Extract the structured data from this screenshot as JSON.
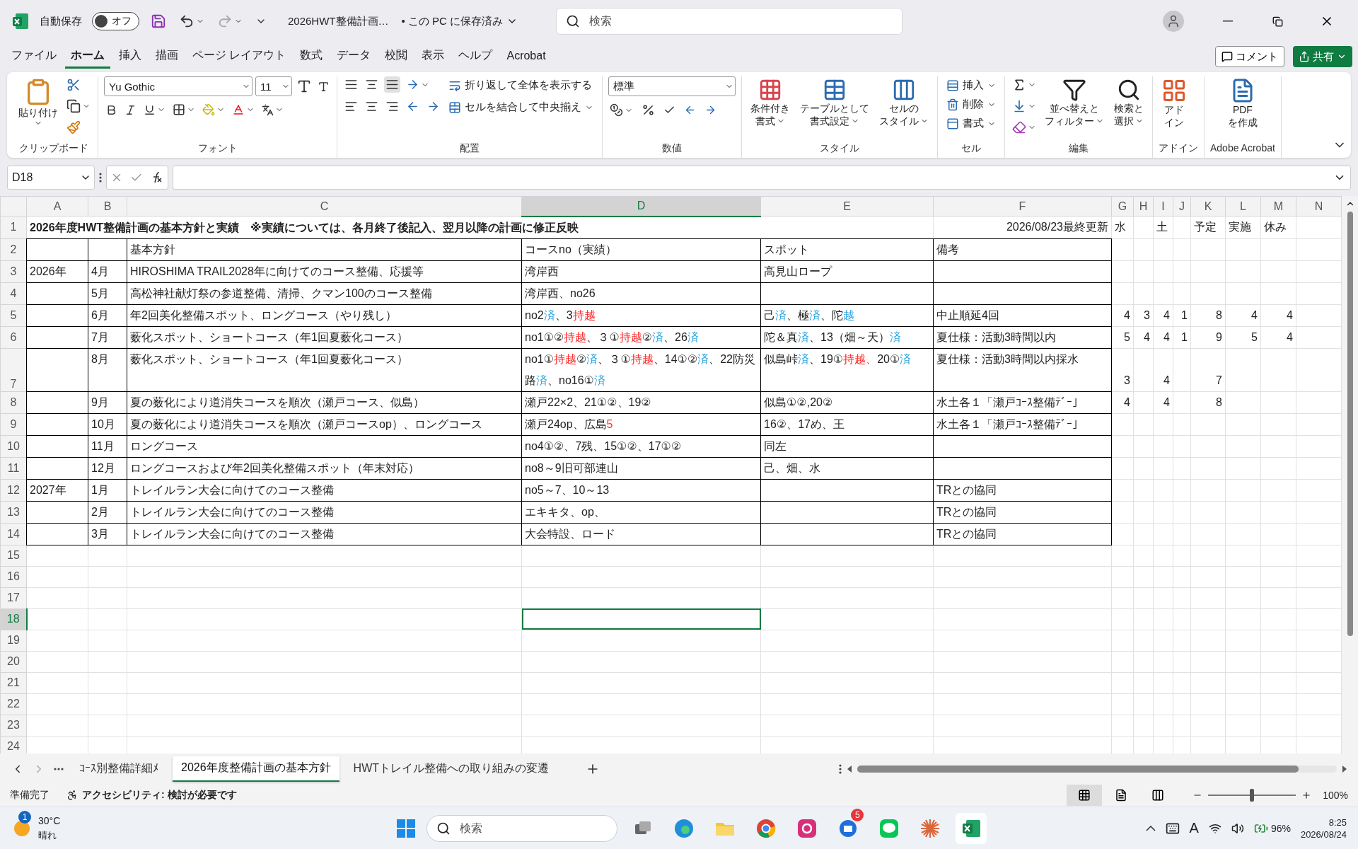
{
  "title_bar": {
    "autosave_label": "自動保存",
    "autosave": {
      "on": false,
      "label": "オフ"
    },
    "file_name": "2026HWT整備計画…",
    "save_status": "• この PC に保存済み",
    "search_placeholder": "検索"
  },
  "menu_tabs": [
    {
      "label": "ファイル",
      "selected": false
    },
    {
      "label": "ホーム",
      "selected": true
    },
    {
      "label": "挿入",
      "selected": false
    },
    {
      "label": "描画",
      "selected": false
    },
    {
      "label": "ページ レイアウト",
      "selected": false
    },
    {
      "label": "数式",
      "selected": false
    },
    {
      "label": "データ",
      "selected": false
    },
    {
      "label": "校閲",
      "selected": false
    },
    {
      "label": "表示",
      "selected": false
    },
    {
      "label": "ヘルプ",
      "selected": false
    },
    {
      "label": "Acrobat",
      "selected": false
    }
  ],
  "comment_button": "コメント",
  "share_button": "共有",
  "ribbon": {
    "clipboard": {
      "label": "クリップボード",
      "paste": "貼り付け"
    },
    "font": {
      "label": "フォント",
      "font_name": "Yu Gothic",
      "font_size": "11"
    },
    "alignment": {
      "label": "配置",
      "wrap": "折り返して全体を表示する",
      "merge": "セルを結合して中央揃え"
    },
    "number": {
      "label": "数値",
      "format": "標準"
    },
    "styles": {
      "label": "スタイル",
      "buttons": [
        [
          "条件付き",
          "書式"
        ],
        [
          "テーブルとして",
          "書式設定"
        ],
        [
          "セルの",
          "スタイル"
        ]
      ]
    },
    "cells": {
      "label": "セル",
      "buttons": [
        "挿入",
        "削除",
        "書式"
      ]
    },
    "editing": {
      "label": "編集",
      "buttons": [
        [
          "並べ替えと",
          "フィルター"
        ],
        [
          "検索と",
          "選択"
        ]
      ]
    },
    "addins": {
      "label": "アドイン",
      "button": [
        "アド",
        "イン"
      ]
    },
    "acrobat": {
      "label": "Adobe Acrobat",
      "button": [
        "PDF",
        "を作成"
      ]
    }
  },
  "formula_bar": {
    "name_box": "D18"
  },
  "sheet": {
    "column_headers": [
      {
        "label": "A",
        "selected": false
      },
      {
        "label": "B",
        "selected": false
      },
      {
        "label": "C",
        "selected": false
      },
      {
        "label": "D",
        "selected": true
      },
      {
        "label": "E",
        "selected": false
      },
      {
        "label": "F",
        "selected": false
      },
      {
        "label": "G",
        "selected": false
      },
      {
        "label": "H",
        "selected": false
      },
      {
        "label": "I",
        "selected": false
      },
      {
        "label": "J",
        "selected": false
      },
      {
        "label": "K",
        "selected": false
      },
      {
        "label": "L",
        "selected": false
      },
      {
        "label": "M",
        "selected": false
      },
      {
        "label": "N",
        "selected": false
      }
    ],
    "row_numbers": [
      {
        "label": "1",
        "selected": false
      },
      {
        "label": "2",
        "selected": false
      },
      {
        "label": "3",
        "selected": false
      },
      {
        "label": "4",
        "selected": false
      },
      {
        "label": "5",
        "selected": false
      },
      {
        "label": "6",
        "selected": false
      },
      {
        "label": "7",
        "selected": false
      },
      {
        "label": "8",
        "selected": false
      },
      {
        "label": "9",
        "selected": false
      },
      {
        "label": "10",
        "selected": false
      },
      {
        "label": "11",
        "selected": false
      },
      {
        "label": "12",
        "selected": false
      },
      {
        "label": "13",
        "selected": false
      },
      {
        "label": "14",
        "selected": false
      },
      {
        "label": "15",
        "selected": false
      },
      {
        "label": "16",
        "selected": false
      },
      {
        "label": "17",
        "selected": false
      },
      {
        "label": "18",
        "selected": true
      },
      {
        "label": "19",
        "selected": false
      },
      {
        "label": "20",
        "selected": false
      },
      {
        "label": "21",
        "selected": false
      },
      {
        "label": "22",
        "selected": false
      },
      {
        "label": "23",
        "selected": false
      },
      {
        "label": "24",
        "selected": false
      }
    ],
    "title": "2026年度HWT整備計画の基本方針と実績　※実績については、各月終了後記入、翌月以降の計画に修正反映",
    "updated": "2026/08/23最終更新",
    "side_labels": {
      "g": "水",
      "i": "土",
      "k": "予定",
      "l": "実施",
      "m": "休み"
    },
    "header": [
      "基本方針",
      "コースno（実績）",
      "スポット",
      "備考"
    ],
    "rows": [
      {
        "year": "2026年",
        "month": "4月",
        "policy": "HIROSHIMA TRAIL2028年に向けてのコース整備、応援等",
        "course": "湾岸西",
        "spot": "高見山ロープ"
      },
      {
        "month": "5月",
        "policy": "高松神社献灯祭の参道整備、清掃、クマン100のコース整備",
        "course": "湾岸西、no26"
      },
      {
        "month": "6月",
        "policy": "年2回美化整備スポット、ロングコース（やり残し）",
        "course": [
          {
            "text": "no2"
          },
          {
            "text": "済",
            "color": "#2ea6e0"
          },
          {
            "text": "、3"
          },
          {
            "text": "持越",
            "color": "#ff2a2a"
          }
        ],
        "spot": [
          {
            "text": "己"
          },
          {
            "text": "済",
            "color": "#2ea6e0"
          },
          {
            "text": "、極"
          },
          {
            "text": "済",
            "color": "#2ea6e0"
          },
          {
            "text": "、陀"
          },
          {
            "text": "越",
            "color": "#2ea6e0"
          }
        ],
        "note": "中止順延4回",
        "counts": {
          "g": "4",
          "h": "3",
          "i": "4",
          "j": "1",
          "k": "8",
          "l": "4",
          "m": "4"
        }
      },
      {
        "month": "7月",
        "policy": "薮化スポット、ショートコース（年1回夏薮化コース）",
        "course": [
          {
            "text": "no1①②"
          },
          {
            "text": "持越",
            "color": "#ff2a2a"
          },
          {
            "text": "、３①"
          },
          {
            "text": "持越",
            "color": "#ff2a2a"
          },
          {
            "text": "②"
          },
          {
            "text": "済",
            "color": "#2ea6e0"
          },
          {
            "text": "、26"
          },
          {
            "text": "済",
            "color": "#2ea6e0"
          }
        ],
        "spot": [
          {
            "text": "陀＆真"
          },
          {
            "text": "済",
            "color": "#2ea6e0"
          },
          {
            "text": "、13（畑～天）"
          },
          {
            "text": "済",
            "color": "#2ea6e0"
          }
        ],
        "note": "夏仕様：活動3時間以内",
        "counts": {
          "g": "5",
          "h": "4",
          "i": "4",
          "j": "1",
          "k": "9",
          "l": "5",
          "m": "4"
        }
      },
      {
        "month": "8月",
        "policy": "薮化スポット、ショートコース（年1回夏薮化コース）",
        "course": [
          {
            "text": "no1①"
          },
          {
            "text": "持越",
            "color": "#ff2a2a"
          },
          {
            "text": "②"
          },
          {
            "text": "済",
            "color": "#2ea6e0"
          },
          {
            "text": "、３①"
          },
          {
            "text": "持越",
            "color": "#ff2a2a"
          },
          {
            "text": "、14①②"
          },
          {
            "text": "済",
            "color": "#2ea6e0"
          },
          {
            "text": "、22防災路"
          },
          {
            "text": "済",
            "color": "#2ea6e0"
          },
          {
            "text": "、no16①"
          },
          {
            "text": "済",
            "color": "#2ea6e0"
          }
        ],
        "spot": [
          {
            "text": "似島峠"
          },
          {
            "text": "済",
            "color": "#2ea6e0"
          },
          {
            "text": "、19①"
          },
          {
            "text": "持越、",
            "color": "#ff2a2a"
          },
          {
            "text": "20①"
          },
          {
            "text": "済",
            "color": "#2ea6e0"
          }
        ],
        "note": "夏仕様：活動3時間以内採水",
        "counts": {
          "g": "3",
          "i": "4",
          "k": "7"
        }
      },
      {
        "month": "9月",
        "policy": "夏の薮化により道消失コースを順次（瀬戸コース、似島）",
        "course": "瀬戸22×2、21①②、19②",
        "spot": "似島①②,20②",
        "note": "水土各１「瀬戸ｺｰｽ整備ﾃﾞｰ」",
        "counts": {
          "g": "4",
          "i": "4",
          "k": "8"
        }
      },
      {
        "month": "10月",
        "policy": "夏の薮化により道消失コースを順次（瀬戸コースop）、ロングコース",
        "course": [
          {
            "text": "瀬戸24op、広島"
          },
          {
            "text": "5",
            "color": "#ff2a2a"
          }
        ],
        "spot": "16②、17め、王",
        "note": "水土各１「瀬戸ｺｰｽ整備ﾃﾞｰ」"
      },
      {
        "month": "11月",
        "policy": "ロングコース",
        "course": "no4①②、7残、15①②、17①②",
        "spot": "同左"
      },
      {
        "month": "12月",
        "policy": "ロングコースおよび年2回美化整備スポット（年末対応）",
        "course": "no8～9旧可部連山",
        "spot": "己、畑、水"
      },
      {
        "year": "2027年",
        "month": "1月",
        "policy": "トレイルラン大会に向けてのコース整備",
        "course": "no5～7、10～13",
        "note": "TRとの協同"
      },
      {
        "month": "2月",
        "policy": "トレイルラン大会に向けてのコース整備",
        "course": "エキキタ、op、",
        "note": "TRとの協同"
      },
      {
        "month": "3月",
        "policy": "トレイルラン大会に向けてのコース整備",
        "course": "大会特設、ロード",
        "note": "TRとの協同"
      }
    ]
  },
  "sheet_tabs": [
    {
      "label": "ｺｰｽ別整備詳細ﾒ",
      "selected": false
    },
    {
      "label": "2026年度整備計画の基本方針",
      "selected": true
    },
    {
      "label": "HWTトレイル整備への取り組みの変遷",
      "selected": false
    }
  ],
  "status_bar": {
    "ready": "準備完了",
    "accessibility": "アクセシビリティ: 検討が必要です",
    "zoom": "100%",
    "zoom_slider": {
      "level": 0.5
    }
  },
  "taskbar": {
    "temperature": "30°C",
    "weather": "晴れ",
    "weather_badge": "1",
    "search_placeholder": "検索",
    "app_badge": "5",
    "ime": "A",
    "battery": "96%",
    "time": "8:25",
    "date": "2026/08/24"
  }
}
